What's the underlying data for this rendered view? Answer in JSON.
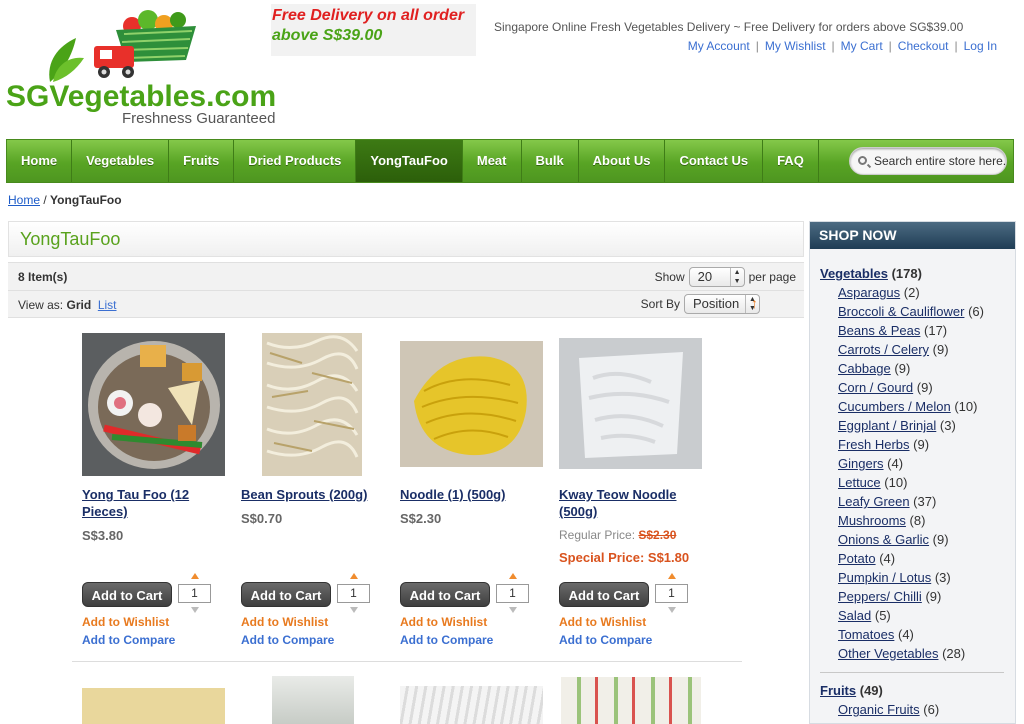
{
  "header": {
    "logo_text": "SGVegetables.com",
    "logo_tagline": "Freshness Guaranteed",
    "promo_line1": "Free Delivery on all order",
    "promo_line2": "above S$39.00",
    "tagline": "Singapore Online Fresh Vegetables Delivery ~ Free Delivery for orders above SG$39.00",
    "top_links": [
      "My Account",
      "My Wishlist",
      "My Cart",
      "Checkout",
      "Log In"
    ]
  },
  "nav": {
    "items": [
      "Home",
      "Vegetables",
      "Fruits",
      "Dried Products",
      "YongTauFoo",
      "Meat",
      "Bulk",
      "About Us",
      "Contact Us",
      "FAQ"
    ],
    "active": "YongTauFoo",
    "search_placeholder": "Search entire store here..."
  },
  "breadcrumb": {
    "home": "Home",
    "sep": "/",
    "current": "YongTauFoo"
  },
  "page": {
    "title": "YongTauFoo",
    "item_count": "8 Item(s)",
    "show_label": "Show",
    "show_value": "20",
    "per_page_label": "per page",
    "view_as_label": "View as:",
    "view_grid": "Grid",
    "view_list": "List",
    "sort_label": "Sort By",
    "sort_value": "Position"
  },
  "products": [
    {
      "name": "Yong Tau Foo (12 Pieces)",
      "price": "S$3.80",
      "qty": "1"
    },
    {
      "name": "Bean Sprouts (200g)",
      "price": "S$0.70",
      "qty": "1"
    },
    {
      "name": "Noodle (1) (500g)",
      "price": "S$2.30",
      "qty": "1"
    },
    {
      "name": "Kway Teow Noodle (500g)",
      "regular_label": "Regular Price:",
      "regular_price": "S$2.30",
      "special_label": "Special Price:",
      "special_price": "S$1.80",
      "qty": "1"
    }
  ],
  "product_actions": {
    "add_to_cart": "Add to Cart",
    "wishlist": "Add to Wishlist",
    "compare": "Add to Compare"
  },
  "sidebar": {
    "title": "SHOP NOW",
    "categories": [
      {
        "name": "Vegetables",
        "count": "(178)",
        "subs": [
          {
            "name": "Asparagus",
            "count": "(2)"
          },
          {
            "name": "Broccoli & Cauliflower",
            "count": "(6)"
          },
          {
            "name": "Beans & Peas",
            "count": "(17)"
          },
          {
            "name": "Carrots / Celery",
            "count": "(9)"
          },
          {
            "name": "Cabbage",
            "count": "(9)"
          },
          {
            "name": "Corn / Gourd",
            "count": "(9)"
          },
          {
            "name": "Cucumbers / Melon",
            "count": "(10)"
          },
          {
            "name": "Eggplant / Brinjal",
            "count": "(3)"
          },
          {
            "name": "Fresh Herbs",
            "count": "(9)"
          },
          {
            "name": "Gingers",
            "count": "(4)"
          },
          {
            "name": "Lettuce",
            "count": "(10)"
          },
          {
            "name": "Leafy Green",
            "count": "(37)"
          },
          {
            "name": "Mushrooms",
            "count": "(8)"
          },
          {
            "name": "Onions & Garlic",
            "count": "(9)"
          },
          {
            "name": "Potato",
            "count": "(4)"
          },
          {
            "name": "Pumpkin / Lotus",
            "count": "(3)"
          },
          {
            "name": "Peppers/ Chilli",
            "count": "(9)"
          },
          {
            "name": "Salad",
            "count": "(5)"
          },
          {
            "name": "Tomatoes",
            "count": "(4)"
          },
          {
            "name": "Other Vegetables",
            "count": "(28)"
          }
        ]
      },
      {
        "name": "Fruits",
        "count": "(49)",
        "subs": [
          {
            "name": "Organic Fruits",
            "count": "(6)"
          }
        ]
      }
    ]
  },
  "colors": {
    "brand_green": "#59a21d",
    "nav_green": "#58a424",
    "orange": "#e87a1f",
    "link_blue": "#3b6fd1",
    "sidebar_header": "#1f3d55"
  }
}
